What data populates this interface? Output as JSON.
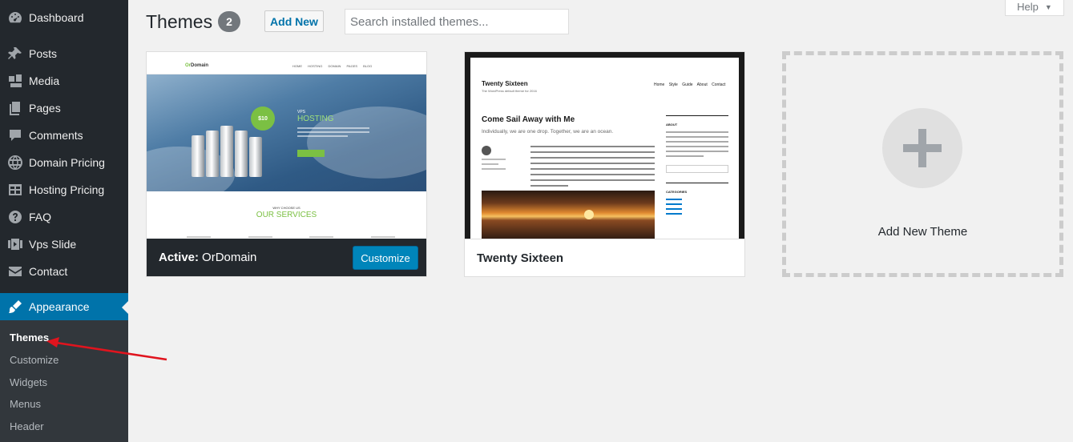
{
  "sidebar": {
    "items": [
      {
        "label": "Dashboard",
        "icon": "dashboard-icon"
      },
      {
        "label": "Posts",
        "icon": "pin-icon"
      },
      {
        "label": "Media",
        "icon": "media-icon"
      },
      {
        "label": "Pages",
        "icon": "pages-icon"
      },
      {
        "label": "Comments",
        "icon": "comment-icon"
      },
      {
        "label": "Domain Pricing",
        "icon": "globe-icon"
      },
      {
        "label": "Hosting Pricing",
        "icon": "table-icon"
      },
      {
        "label": "FAQ",
        "icon": "help-icon"
      },
      {
        "label": "Vps Slide",
        "icon": "slides-icon"
      },
      {
        "label": "Contact",
        "icon": "mail-icon"
      },
      {
        "label": "Appearance",
        "icon": "brush-icon"
      }
    ],
    "submenu": [
      "Themes",
      "Customize",
      "Widgets",
      "Menus",
      "Header"
    ]
  },
  "header": {
    "title": "Themes",
    "count": "2",
    "add_new": "Add New",
    "search_placeholder": "Search installed themes...",
    "help": "Help"
  },
  "themes": {
    "active": {
      "prefix": "Active:",
      "name": "OrDomain",
      "customize": "Customize",
      "preview": {
        "logo_a": "Or",
        "logo_b": "Domain",
        "nav": "HOME HOSTING DOMAIN PAGES BLOG",
        "vps": "VPS",
        "hosting": "HOSTING",
        "price": "$10",
        "why": "WHY CHOOSE US",
        "services": "OUR SERVICES"
      }
    },
    "second": {
      "name": "Twenty Sixteen",
      "preview": {
        "site_title": "Twenty Sixteen",
        "tagline": "The WordPress default theme for 2016",
        "nav": "Home Style Guide About Contact",
        "post_title": "Come Sail Away with Me",
        "excerpt": "Individually, we are one drop. Together, we are an ocean.",
        "about": "ABOUT",
        "categories": "CATEGORIES"
      }
    },
    "add_new_label": "Add New Theme"
  },
  "colors": {
    "sidebar_bg": "#23282d",
    "submenu_bg": "#32373c",
    "accent": "#0073aa",
    "button_primary": "#0085ba",
    "annotation_arrow": "#e0141e"
  }
}
